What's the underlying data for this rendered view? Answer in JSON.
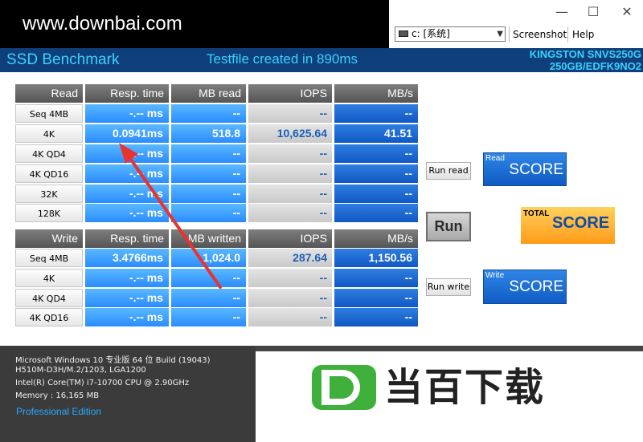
{
  "window": {
    "minimize_glyph": "—",
    "maximize_glyph": "☐",
    "close_glyph": "✕"
  },
  "toolbar": {
    "drive_value": "c: [系统]",
    "screenshot_label": "Screenshot",
    "help_label": "Help"
  },
  "watermark": {
    "text": "www.downbai.com"
  },
  "header": {
    "title": "SSD Benchmark",
    "testfile_msg": "Testfile created in 890ms",
    "drive_model_line1": "KINGSTON SNVS250G",
    "drive_model_line2": "250GB/EDFK9NO2"
  },
  "read": {
    "headers": [
      "Read",
      "Resp. time",
      "MB read",
      "IOPS",
      "MB/s"
    ],
    "rows": [
      {
        "label": "Seq 4MB",
        "resp": "-.-- ms",
        "mb": "--",
        "iops": "--",
        "mbs": "--"
      },
      {
        "label": "4K",
        "resp": "0.0941ms",
        "mb": "518.8",
        "iops": "10,625.64",
        "mbs": "41.51"
      },
      {
        "label": "4K QD4",
        "resp": "-.-- ms",
        "mb": "--",
        "iops": "--",
        "mbs": "--"
      },
      {
        "label": "4K QD16",
        "resp": "-.-- ms",
        "mb": "--",
        "iops": "--",
        "mbs": "--"
      },
      {
        "label": "32K",
        "resp": "-.-- ms",
        "mb": "--",
        "iops": "--",
        "mbs": "--"
      },
      {
        "label": "128K",
        "resp": "-.-- ms",
        "mb": "--",
        "iops": "--",
        "mbs": "--"
      }
    ]
  },
  "write": {
    "headers": [
      "Write",
      "Resp. time",
      "MB written",
      "IOPS",
      "MB/s"
    ],
    "rows": [
      {
        "label": "Seq 4MB",
        "resp": "3.4766ms",
        "mb": "1,024.0",
        "iops": "287.64",
        "mbs": "1,150.56"
      },
      {
        "label": "4K",
        "resp": "-.-- ms",
        "mb": "--",
        "iops": "--",
        "mbs": "--"
      },
      {
        "label": "4K QD4",
        "resp": "-.-- ms",
        "mb": "--",
        "iops": "--",
        "mbs": "--"
      },
      {
        "label": "4K QD16",
        "resp": "-.-- ms",
        "mb": "--",
        "iops": "--",
        "mbs": "--"
      }
    ]
  },
  "controls": {
    "run_read_label": "Run read",
    "run_label": "Run",
    "run_write_label": "Run write",
    "read_score_small": "Read",
    "read_score_big": "SCORE",
    "total_score_small": "TOTAL",
    "total_score_big": "SCORE",
    "write_score_small": "Write",
    "write_score_big": "SCORE"
  },
  "sysinfo": {
    "os": "Microsoft Windows 10 专业版 64 位 Build (19043)",
    "board": "H510M-D3H/M.2/1203, LGA1200",
    "cpu": "Intel(R) Core(TM) i7-10700 CPU @ 2.90GHz",
    "memory": "Memory : 16,165 MB",
    "edition": "Professional Edition"
  },
  "brand": {
    "text": "当百下载",
    "logo_letter": "D"
  },
  "colors": {
    "header_bg": "#0e3f7a",
    "header_text": "#3bd1ff",
    "cell_blue": "#2a8cff",
    "total_score": "#ff9b1a",
    "arrow": "#e8332e",
    "brand_green": "#3fb03b"
  }
}
